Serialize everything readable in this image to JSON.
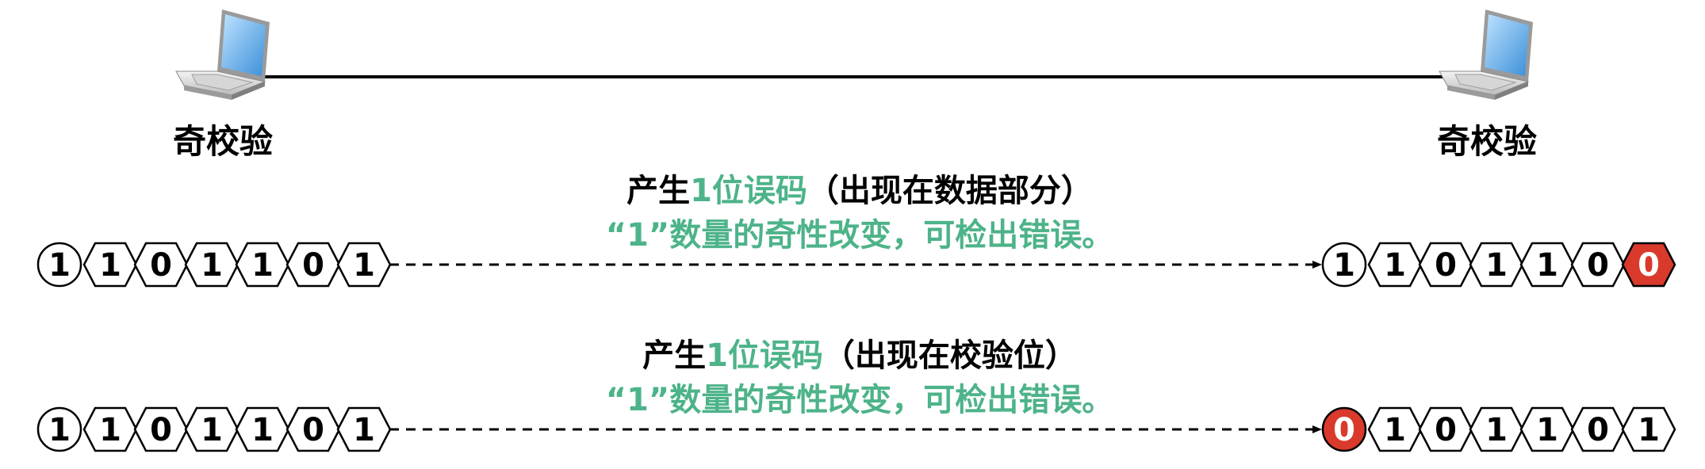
{
  "colors": {
    "accent_green": "#4db389",
    "error_red": "#d93a2b",
    "line": "#000000",
    "text": "#000000"
  },
  "hosts": {
    "left_label": "奇校验",
    "right_label": "奇校验",
    "icon": "laptop-icon"
  },
  "scenarios": [
    {
      "title_prefix": "产生",
      "title_highlight": "1位误码",
      "title_suffix": "（出现在数据部分）",
      "result": "“1”数量的奇性改变，可检出错误。",
      "sent_bits": [
        "1",
        "1",
        "0",
        "1",
        "1",
        "0",
        "1"
      ],
      "received_bits": [
        "1",
        "1",
        "0",
        "1",
        "1",
        "0",
        "0"
      ],
      "error_index": 6
    },
    {
      "title_prefix": "产生",
      "title_highlight": "1位误码",
      "title_suffix": "（出现在校验位）",
      "result": "“1”数量的奇性改变，可检出错误。",
      "sent_bits": [
        "1",
        "1",
        "0",
        "1",
        "1",
        "0",
        "1"
      ],
      "received_bits": [
        "0",
        "1",
        "0",
        "1",
        "1",
        "0",
        "1"
      ],
      "error_index": 0
    }
  ]
}
